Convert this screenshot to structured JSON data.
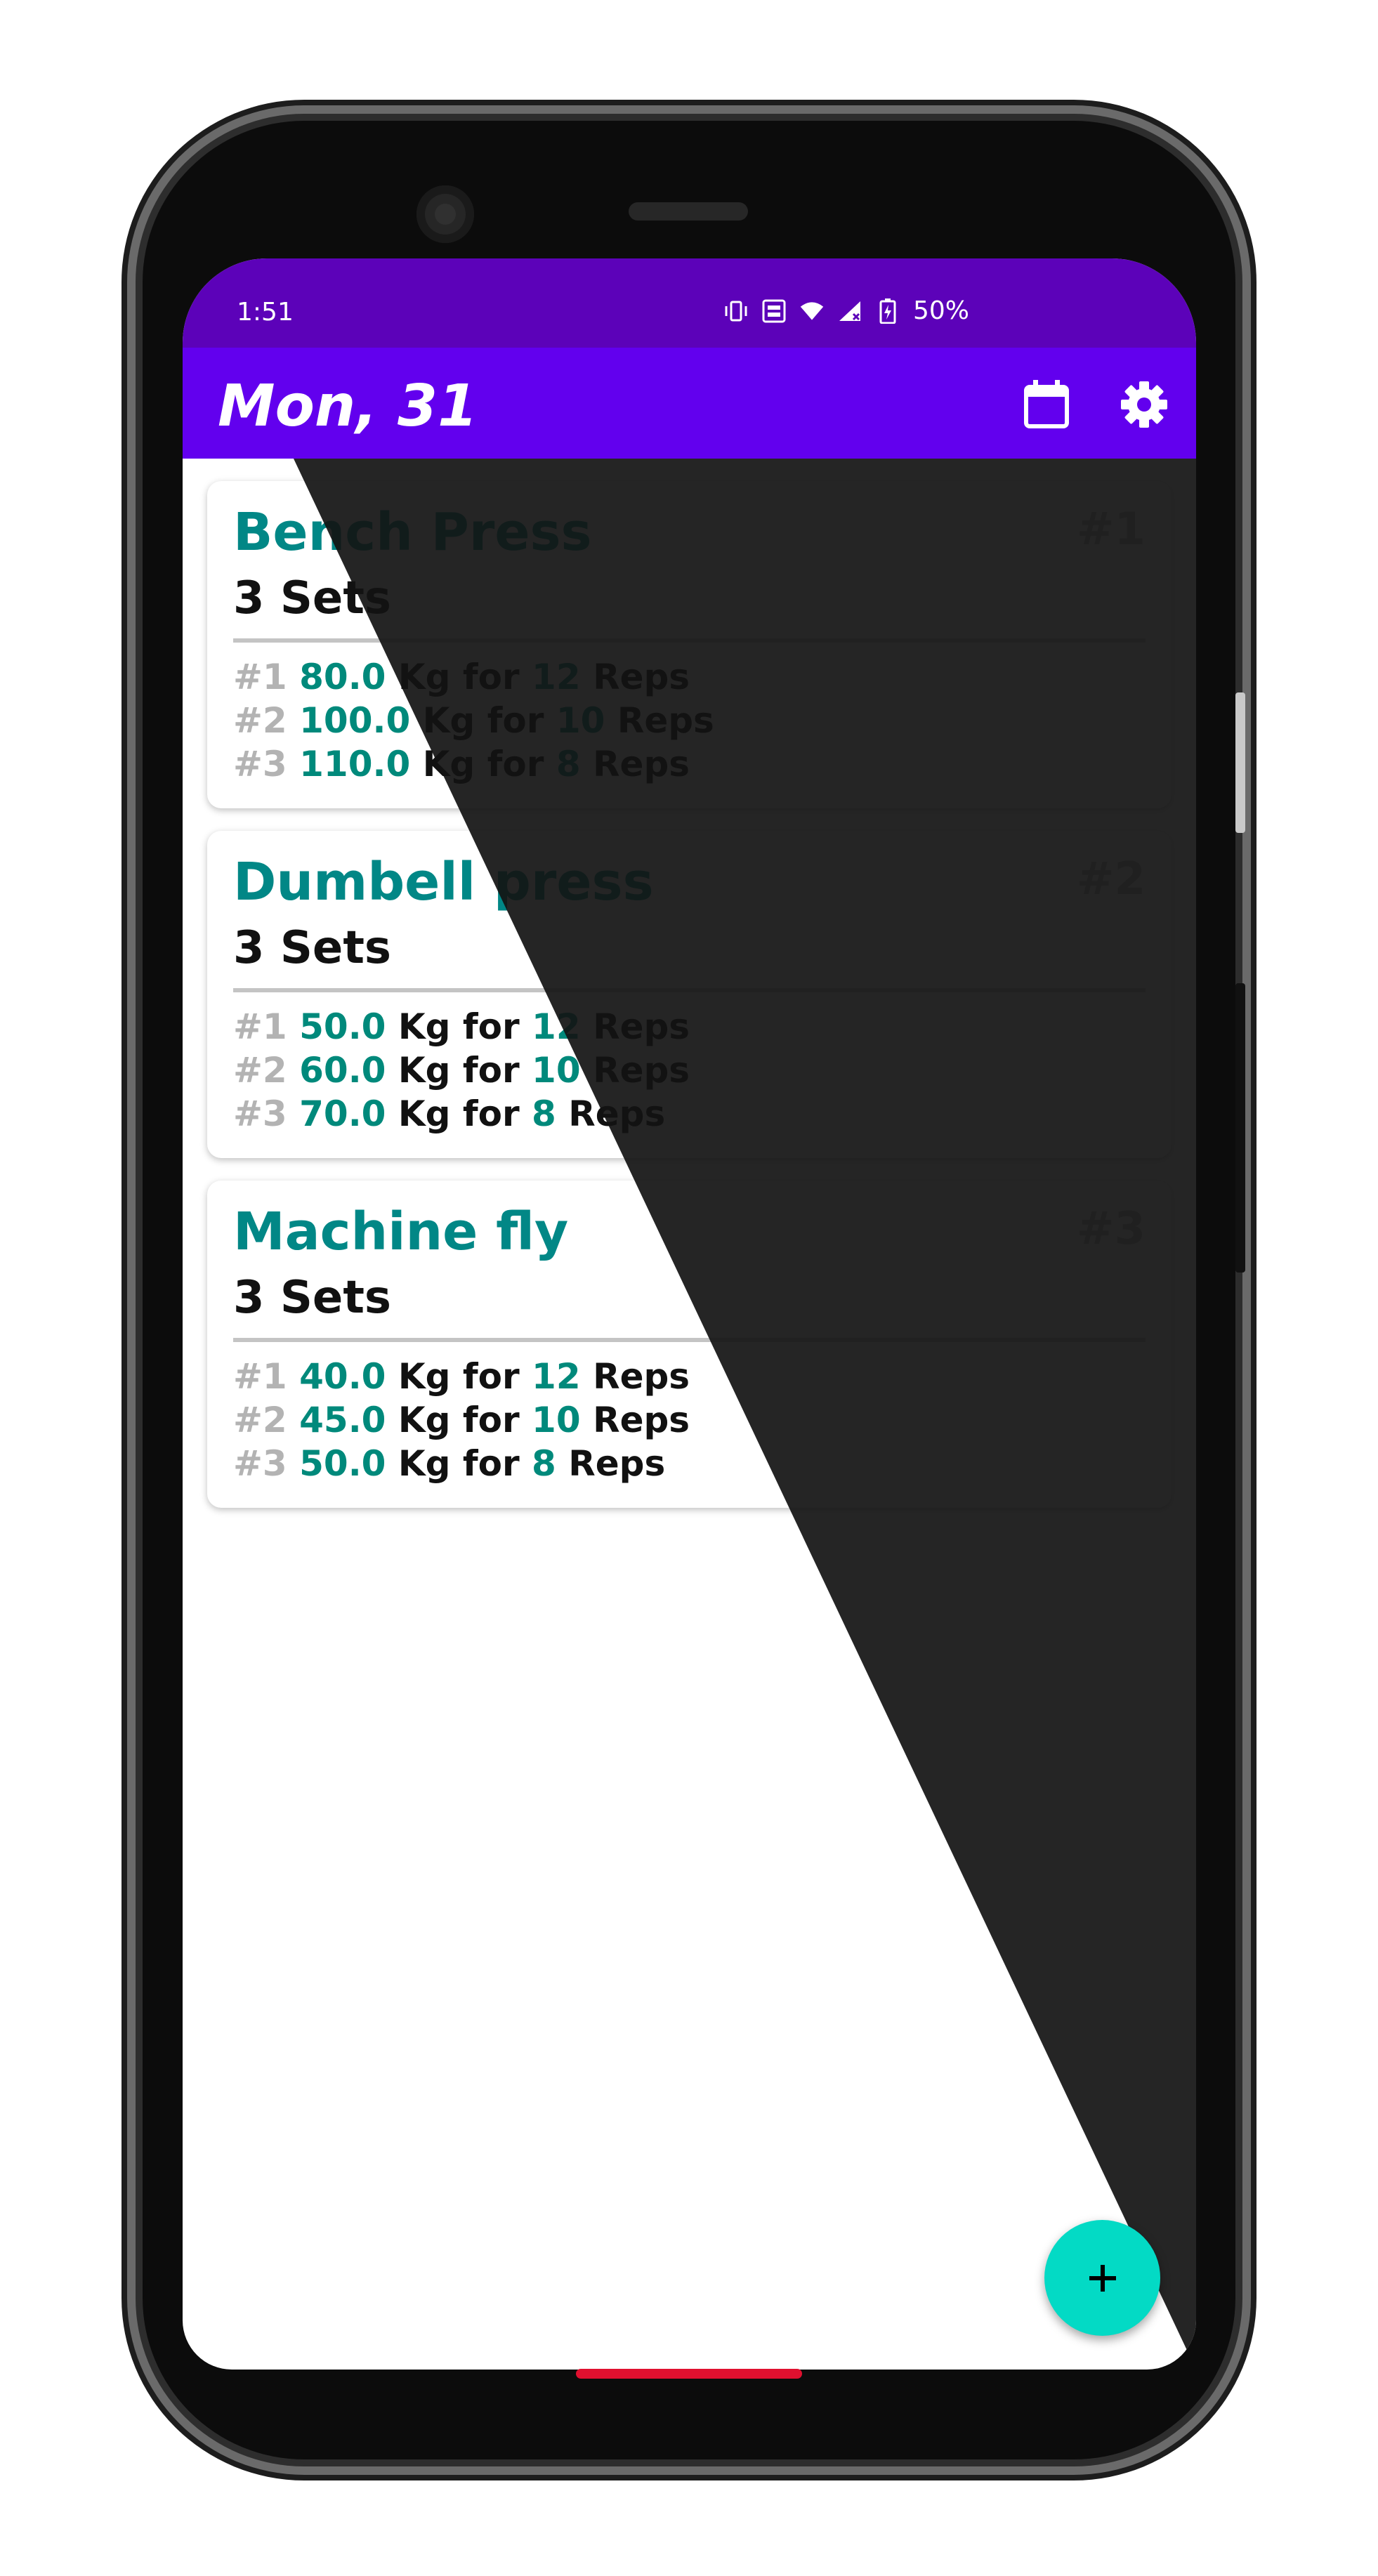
{
  "status": {
    "time": "1:51",
    "battery": "50%",
    "icons": [
      "vibrate-icon",
      "volte-icon",
      "wifi-icon",
      "signal-icon",
      "battery-icon"
    ]
  },
  "appbar": {
    "title": "Mon, 31",
    "icons": [
      "calendar-icon",
      "settings-icon"
    ]
  },
  "exercises": [
    {
      "name": "Bench Press",
      "index": "#1",
      "sets_label": "3 Sets",
      "sets": [
        {
          "num": "#1",
          "weight": "80.0",
          "unit": "Kg for",
          "reps": "12",
          "reps_label": "Reps"
        },
        {
          "num": "#2",
          "weight": "100.0",
          "unit": "Kg for",
          "reps": "10",
          "reps_label": "Reps"
        },
        {
          "num": "#3",
          "weight": "110.0",
          "unit": "Kg for",
          "reps": "8",
          "reps_label": "Reps"
        }
      ]
    },
    {
      "name": "Dumbell press",
      "index": "#2",
      "sets_label": "3 Sets",
      "sets": [
        {
          "num": "#1",
          "weight": "50.0",
          "unit": "Kg for",
          "reps": "12",
          "reps_label": "Reps"
        },
        {
          "num": "#2",
          "weight": "60.0",
          "unit": "Kg for",
          "reps": "10",
          "reps_label": "Reps"
        },
        {
          "num": "#3",
          "weight": "70.0",
          "unit": "Kg for",
          "reps": "8",
          "reps_label": "Reps"
        }
      ]
    },
    {
      "name": "Machine fly",
      "index": "#3",
      "sets_label": "3 Sets",
      "sets": [
        {
          "num": "#1",
          "weight": "40.0",
          "unit": "Kg for",
          "reps": "12",
          "reps_label": "Reps"
        },
        {
          "num": "#2",
          "weight": "45.0",
          "unit": "Kg for",
          "reps": "10",
          "reps_label": "Reps"
        },
        {
          "num": "#3",
          "weight": "50.0",
          "unit": "Kg for",
          "reps": "8",
          "reps_label": "Reps"
        }
      ]
    }
  ],
  "fab": {
    "icon": "plus-icon",
    "symbol": "+"
  },
  "colors": {
    "status_bar": "#5c02b9",
    "app_bar": "#6200ee",
    "accent_teal": "#018786",
    "fab": "#03dac5",
    "dark_theme_bg": "#121212"
  }
}
